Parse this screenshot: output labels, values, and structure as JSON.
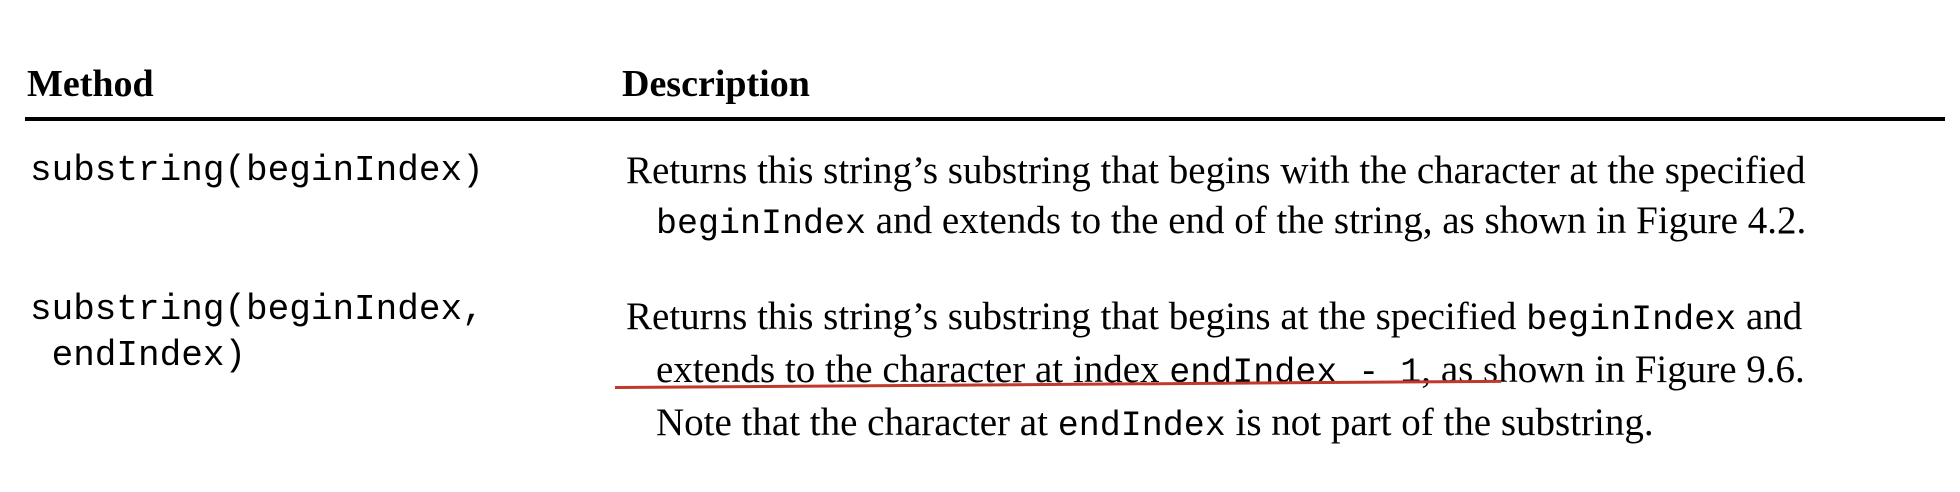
{
  "table": {
    "headers": {
      "method": "Method",
      "description": "Description"
    },
    "rows": [
      {
        "method_line1": "substring(beginIndex)",
        "method_line2": "",
        "desc": {
          "l1": "Returns this string’s substring that begins with the character at the specified",
          "l2_code": "beginIndex",
          "l2_text": " and extends to the end of the string, as shown in Figure 4.2."
        }
      },
      {
        "method_line1": "substring(beginIndex,",
        "method_line2": " endIndex)",
        "desc": {
          "l1_text": "Returns this string’s substring that begins at the specified ",
          "l1_code": "beginIndex",
          "l1_text2": " and",
          "l2_text": "extends to the character at index ",
          "l2_code": "endIndex - 1",
          "l2_text2": ", as shown in Figure 9.6.",
          "l3_text": "Note that the character at ",
          "l3_code": "endIndex",
          "l3_text2": " is not part of the substring."
        }
      }
    ]
  },
  "annotation": {
    "underline_color": "#c0392b"
  }
}
